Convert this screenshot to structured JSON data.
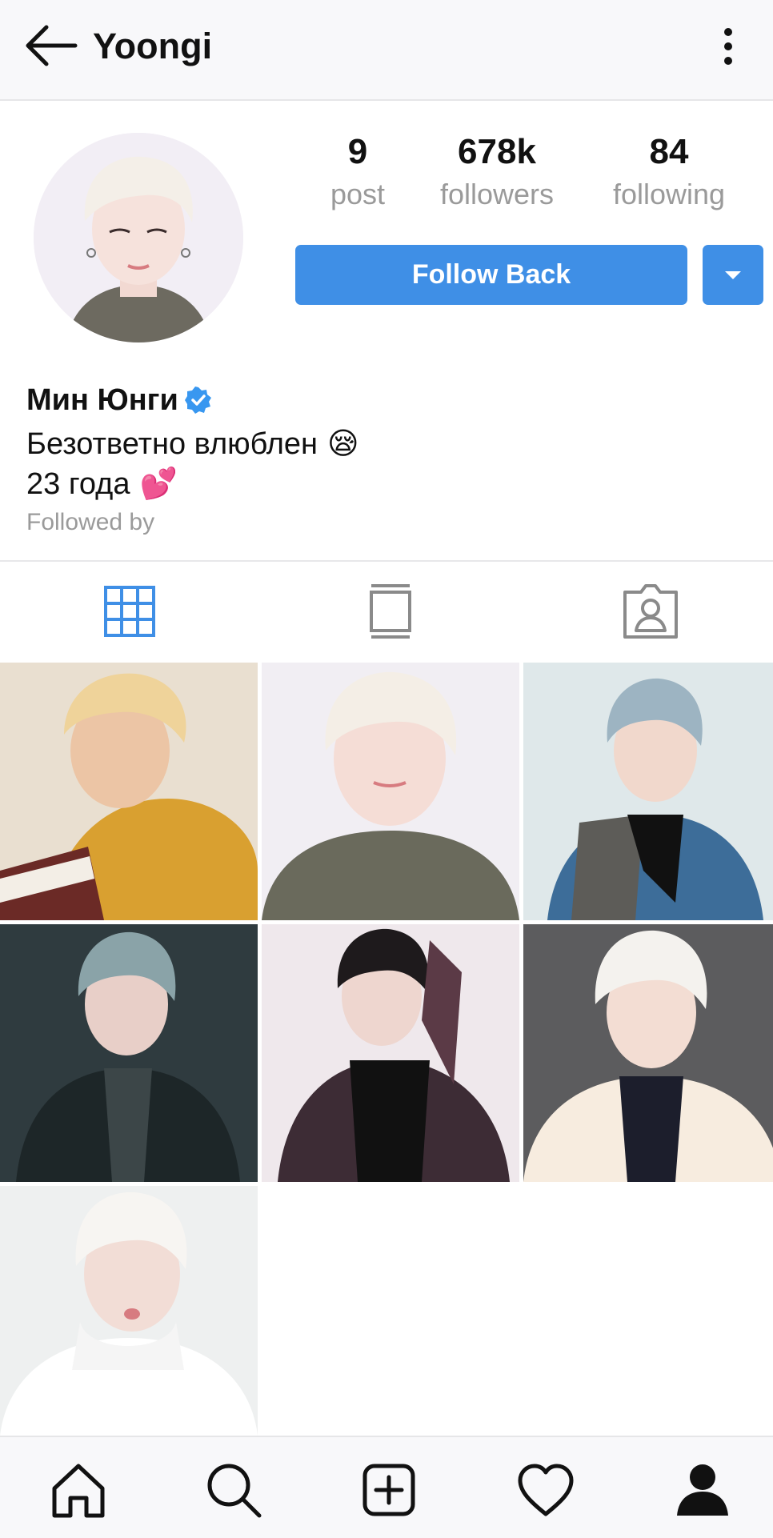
{
  "header": {
    "title": "Yoongi",
    "back_icon": "arrow-left-icon",
    "menu_icon": "more-vertical-icon"
  },
  "profile": {
    "stats": [
      {
        "value": "9",
        "label": "post"
      },
      {
        "value": "678k",
        "label": "followers"
      },
      {
        "value": "84",
        "label": "following"
      }
    ],
    "follow_button_label": "Follow Back",
    "name": "Мин Юнги",
    "verified": true,
    "bio_line1": "Безответно влюблен",
    "bio_line1_emoji": "😪",
    "bio_line2": "23 года",
    "bio_line2_emoji": "💕",
    "followed_by": "Followed by"
  },
  "tabs": [
    {
      "icon": "grid-icon",
      "active": true
    },
    {
      "icon": "feed-icon",
      "active": false
    },
    {
      "icon": "tagged-person-icon",
      "active": false
    }
  ],
  "posts_count_shown": 7,
  "bottom_nav": [
    {
      "icon": "home-icon"
    },
    {
      "icon": "search-icon"
    },
    {
      "icon": "add-post-icon"
    },
    {
      "icon": "heart-icon"
    },
    {
      "icon": "profile-icon",
      "active": true
    }
  ],
  "colors": {
    "accent": "#3f8fe6",
    "header_bg": "#f8f8fa",
    "muted_text": "#9a9a9a",
    "verified": "#3897f0"
  }
}
